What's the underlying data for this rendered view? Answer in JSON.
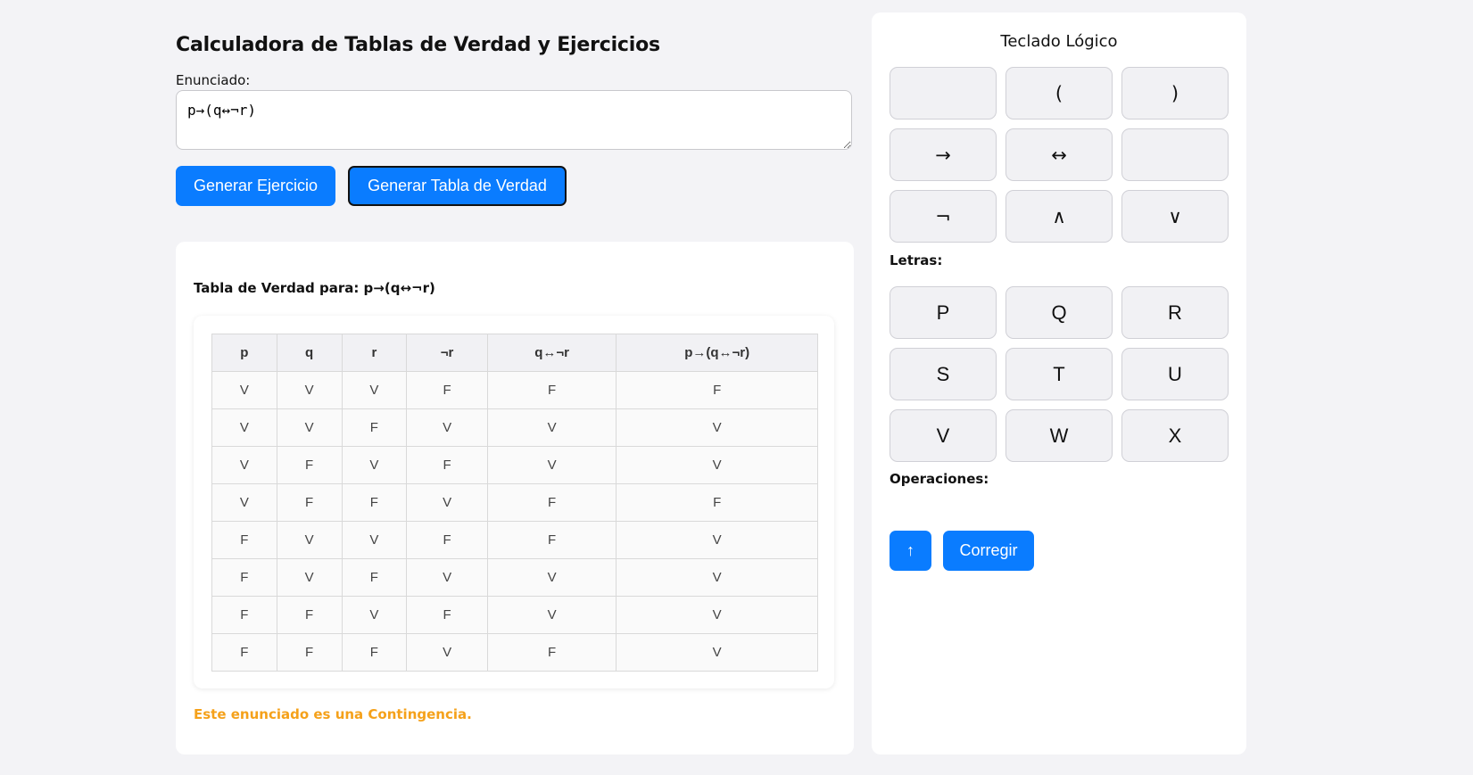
{
  "header": {
    "title": "Calculadora de Tablas de Verdad y Ejercicios"
  },
  "input": {
    "label": "Enunciado:",
    "value": "p→(q↔¬r)"
  },
  "buttons": {
    "generate_exercise": "Generar Ejercicio",
    "generate_table": "Generar Tabla de Verdad"
  },
  "result": {
    "title": "Tabla de Verdad para: p→(q↔¬r)",
    "columns": [
      "p",
      "q",
      "r",
      "¬r",
      "q↔¬r",
      "p→(q↔¬r)"
    ],
    "rows": [
      [
        "V",
        "V",
        "V",
        "F",
        "F",
        "F"
      ],
      [
        "V",
        "V",
        "F",
        "V",
        "V",
        "V"
      ],
      [
        "V",
        "F",
        "V",
        "F",
        "V",
        "V"
      ],
      [
        "V",
        "F",
        "F",
        "V",
        "F",
        "F"
      ],
      [
        "F",
        "V",
        "V",
        "F",
        "F",
        "V"
      ],
      [
        "F",
        "V",
        "F",
        "V",
        "V",
        "V"
      ],
      [
        "F",
        "F",
        "V",
        "F",
        "V",
        "V"
      ],
      [
        "F",
        "F",
        "F",
        "V",
        "F",
        "V"
      ]
    ],
    "message": "Este enunciado es una Contingencia.",
    "message_color": "#f5a11a"
  },
  "keyboard": {
    "title": "Teclado Lógico",
    "symbols": [
      "",
      "(",
      ")",
      "→",
      "↔",
      "",
      "¬",
      "∧",
      "∨"
    ],
    "letters_label": "Letras:",
    "letters": [
      "P",
      "Q",
      "R",
      "S",
      "T",
      "U",
      "V",
      "W",
      "X"
    ],
    "operations_label": "Operaciones:",
    "operations": {
      "up": "↑",
      "correct": "Corregir"
    }
  },
  "colors": {
    "accent": "#0a7cff",
    "background": "#f3f3f6"
  }
}
